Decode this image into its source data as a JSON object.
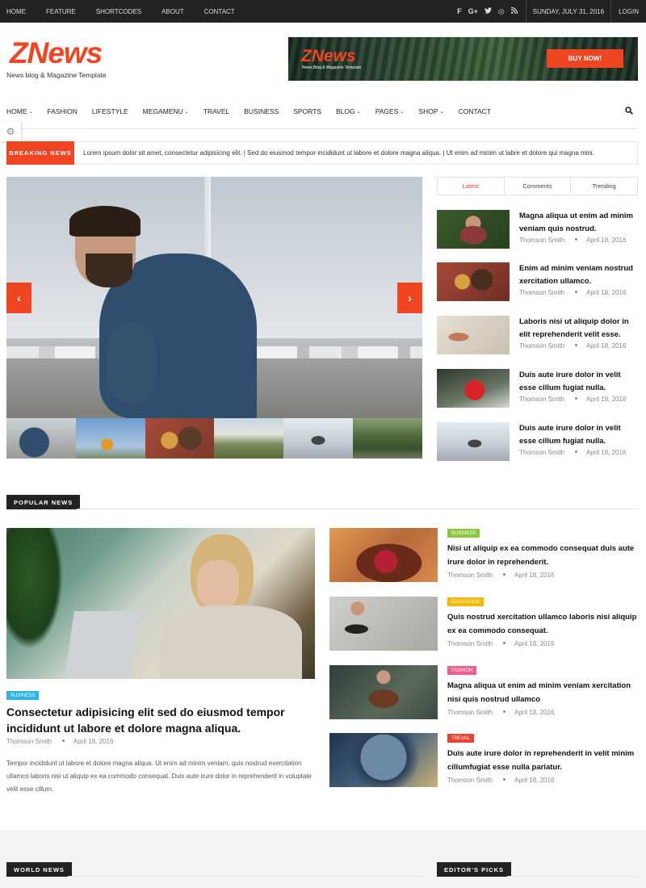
{
  "topbar": {
    "nav": [
      "HOME",
      "FEATURE",
      "SHORTCODES",
      "ABOUT",
      "CONTACT"
    ],
    "social_icons": [
      "facebook-icon",
      "google-plus-icon",
      "twitter-icon",
      "dribbble-icon",
      "rss-icon"
    ],
    "date": "SUNDAY, JULY 31, 2016",
    "login": "LOGIN"
  },
  "brand": {
    "logo": "ZNews",
    "tagline": "News blog & Magazine Template",
    "accent": "#f04523"
  },
  "banner": {
    "logo": "ZNews",
    "tagline": "News,Blog & Magazine Template",
    "button": "BUY NOW!"
  },
  "nav": {
    "items": [
      {
        "label": "HOME",
        "caret": "⌄"
      },
      {
        "label": "FASHION",
        "caret": ""
      },
      {
        "label": "LIFESTYLE",
        "caret": ""
      },
      {
        "label": "MEGAMENU",
        "caret": "⌄"
      },
      {
        "label": "TRAVEL",
        "caret": ""
      },
      {
        "label": "BUSINESS",
        "caret": ""
      },
      {
        "label": "SPORTS",
        "caret": ""
      },
      {
        "label": "BLOG",
        "caret": "⌄"
      },
      {
        "label": "PAGES",
        "caret": "⌄"
      },
      {
        "label": "SHOP",
        "caret": "⌄"
      },
      {
        "label": "CONTACT",
        "caret": ""
      }
    ]
  },
  "breaking": {
    "label": "BREAKING NEWS",
    "text": "Lorem ipsum dolor sit amet, consectetur adipisicing elit. | Sed do eiusmod tempor incididunt ut labore et dolore magna aliqua. | Ut enim ad minim ut labre et dolore qui magna mini."
  },
  "slider": {
    "prev": "‹",
    "next": "›"
  },
  "sidebar": {
    "tabs": [
      "Latest",
      "Comments",
      "Trending"
    ],
    "items": [
      {
        "title": "Magna aliqua ut enim ad minim veniam quis nostrud.",
        "author": "Thomson Smith",
        "date": "April 18, 2016"
      },
      {
        "title": "Enim ad minim veniam nostrud xercitation ullamco.",
        "author": "Thomson Smith",
        "date": "April 18, 2016"
      },
      {
        "title": "Laboris nisi ut aliquip dolor in elit reprehenderit velit esse.",
        "author": "Thomson Smith",
        "date": "April 18, 2016"
      },
      {
        "title": "Duis aute irure dolor in velit esse cillum fugiat nulla.",
        "author": "Thomson Smith",
        "date": "April 18, 2016"
      },
      {
        "title": "Duis aute irure dolor in velit esse cillum fugiat nulla.",
        "author": "Thomson Smith",
        "date": "April 18, 2016"
      }
    ]
  },
  "popular": {
    "heading": "POPULAR NEWS",
    "main": {
      "badge": "BUSINESS",
      "title": "Consectetur adipisicing elit sed do eiusmod tempor incididunt ut labore et dolore magna aliqua.",
      "author": "Thomson Smith",
      "date": "April 18, 2016",
      "desc": "Tempor incididunt ut labore et dolore magna aliqua. Ut enim ad minim veniam, quis nostrud exercitation ullamco laboris nisi ut aliquip ex ea commodo consequat. Duis aute irure dolor in reprehenderit in voluptate velit esse cillum."
    },
    "items": [
      {
        "badge": "BUSINESS",
        "badge_color": "#8dc63f",
        "title": "Nisi ut aliquip ex ea commodo consequat duis aute irure dolor in reprehenderit.",
        "author": "Thomson Smith",
        "date": "April 18, 2016"
      },
      {
        "badge": "EDUCATION",
        "badge_color": "#f5b800",
        "title": "Quis nostrud xercitation ullamco laboris nisi aliquip ex ea commodo consequat.",
        "author": "Thomson Smith",
        "date": "April 18, 2016"
      },
      {
        "badge": "FASHION",
        "badge_color": "#ee5f8f",
        "title": "Magna aliqua ut enim ad minim veniam xercitation nisi quis nostrud ullamco",
        "author": "Thomson Smith",
        "date": "April 18, 2016"
      },
      {
        "badge": "TREVAL",
        "badge_color": "#e8432f",
        "title": "Duis aute irure dolor in reprehenderit in velit minim cillumfugiat esse nulla pariatur.",
        "author": "Thomson Smith",
        "date": "April 18, 2016"
      }
    ]
  },
  "world": {
    "heading": "WORLD NEWS"
  },
  "editors": {
    "heading": "EDITOR'S PICKS"
  }
}
